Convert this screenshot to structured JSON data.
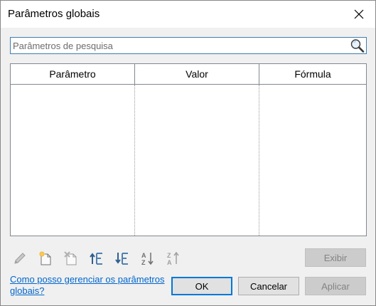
{
  "dialog": {
    "title": "Parâmetros globais"
  },
  "search": {
    "placeholder": "Parâmetros de pesquisa",
    "value": ""
  },
  "grid": {
    "columns": [
      "Parâmetro",
      "Valor",
      "Fórmula"
    ],
    "rows": []
  },
  "toolbar": {
    "icons": [
      "edit-pencil-icon",
      "new-parameter-icon",
      "delete-parameter-icon",
      "move-up-icon",
      "move-down-icon",
      "sort-ascending-icon",
      "sort-descending-icon"
    ]
  },
  "buttons": {
    "exibir": "Exibir",
    "ok": "OK",
    "cancelar": "Cancelar",
    "aplicar": "Aplicar"
  },
  "help": {
    "link": "Como posso gerenciar os parâmetros globais?"
  },
  "colors": {
    "accent": "#0078d7",
    "link": "#0066cc",
    "disabled_text": "#838383"
  }
}
